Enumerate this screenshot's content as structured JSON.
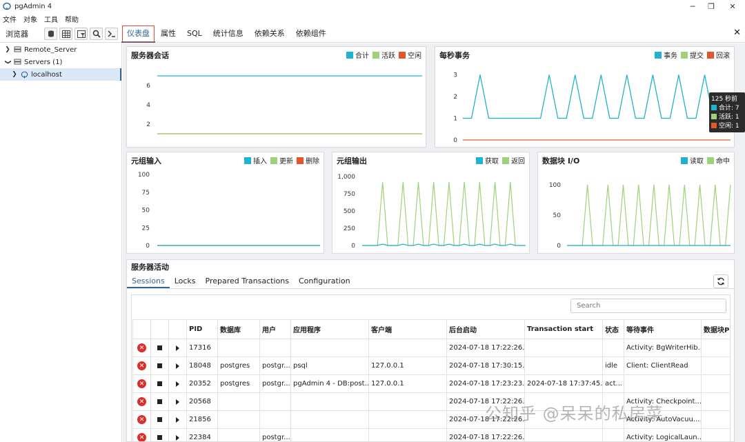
{
  "window": {
    "title": "pgAdmin 4"
  },
  "menu": [
    "文件",
    "对象",
    "工具",
    "帮助"
  ],
  "toolbar": {
    "browser_label": "浏览器",
    "tabs": [
      "仪表盘",
      "属性",
      "SQL",
      "统计信息",
      "依赖关系",
      "依赖组件"
    ],
    "active_tab": "仪表盘",
    "icons": [
      "database-icon",
      "table-icon",
      "filter-table-icon",
      "search-icon",
      "terminal-icon"
    ]
  },
  "tree": [
    {
      "label": "Remote_Server",
      "expanded": false,
      "icon": "server-group-icon"
    },
    {
      "label": "Servers (1)",
      "expanded": true,
      "icon": "server-group-icon"
    },
    {
      "label": "localhost",
      "expanded": false,
      "icon": "postgres-server-icon",
      "selected": true
    }
  ],
  "colors": {
    "blue": "#1fb3d1",
    "green": "#9ed27a",
    "orange": "#e3552a",
    "accent": "#326690"
  },
  "panels": {
    "sessions": {
      "title": "服务器会话",
      "legend": [
        "合计",
        "活跃",
        "空闲"
      ]
    },
    "tps": {
      "title": "每秒事务",
      "legend": [
        "事务",
        "提交",
        "回滚"
      ]
    },
    "tuples_in": {
      "title": "元组输入",
      "legend": [
        "插入",
        "更新",
        "删除"
      ]
    },
    "tuples_out": {
      "title": "元组输出",
      "legend": [
        "获取",
        "返回"
      ]
    },
    "block_io": {
      "title": "数据块 I/O",
      "legend": [
        "读取",
        "命中"
      ]
    }
  },
  "tooltip": {
    "title": "125 秒前",
    "rows": [
      "合计: 7",
      "活跃: 1",
      "空闲: 1"
    ]
  },
  "chart_data": [
    {
      "type": "line",
      "title": "服务器会话",
      "yticks": [
        "2",
        "4",
        "6"
      ],
      "ylim": [
        0,
        8
      ],
      "series": [
        {
          "name": "合计",
          "color": "#1fb3d1",
          "values": [
            7,
            7,
            7,
            7,
            7,
            7,
            7,
            7,
            7,
            7,
            7,
            7,
            7
          ]
        },
        {
          "name": "活跃",
          "color": "#9ed27a",
          "values": [
            1,
            1,
            1,
            1,
            1,
            1,
            1,
            1,
            1,
            1,
            1,
            1,
            1
          ]
        },
        {
          "name": "空闲",
          "color": "#e3552a",
          "values": [
            1,
            1,
            1,
            1,
            1,
            1,
            1,
            1,
            1,
            1,
            1,
            1,
            1
          ]
        }
      ]
    },
    {
      "type": "line",
      "title": "每秒事务",
      "yticks": [
        "0",
        "1",
        "2",
        "3"
      ],
      "ylim": [
        0,
        3.3
      ],
      "series": [
        {
          "name": "事务",
          "color": "#1fb3d1",
          "values": [
            1,
            1,
            3,
            1,
            1,
            1,
            1,
            1,
            1,
            1,
            3,
            1,
            1,
            3,
            1,
            1,
            3,
            1,
            1,
            3,
            1,
            1,
            3,
            1,
            1,
            3,
            1,
            1,
            3,
            1,
            1,
            1
          ]
        },
        {
          "name": "提交",
          "color": "#9ed27a",
          "values": [
            1,
            1,
            3,
            1,
            1,
            1,
            1,
            1,
            1,
            1,
            3,
            1,
            1,
            3,
            1,
            1,
            3,
            1,
            1,
            3,
            1,
            1,
            3,
            1,
            1,
            3,
            1,
            1,
            3,
            1,
            1,
            1
          ]
        },
        {
          "name": "回滚",
          "color": "#e3552a",
          "values": [
            0,
            0,
            0,
            0,
            0,
            0,
            0,
            0,
            0,
            0,
            0,
            0,
            0,
            0,
            0,
            0,
            0,
            0,
            0,
            0,
            0,
            0,
            0,
            0,
            0,
            0,
            0,
            0,
            0,
            0,
            0,
            0
          ]
        }
      ]
    },
    {
      "type": "line",
      "title": "元组输入",
      "yticks": [
        "0",
        "25",
        "50",
        "75",
        "100"
      ],
      "ylim": [
        0,
        100
      ],
      "series": [
        {
          "name": "插入",
          "color": "#1fb3d1",
          "values": [
            0,
            0,
            0,
            0,
            0,
            0,
            0,
            0,
            0,
            0
          ]
        },
        {
          "name": "更新",
          "color": "#9ed27a",
          "values": [
            0,
            0,
            0,
            0,
            0,
            0,
            0,
            0,
            0,
            0
          ]
        },
        {
          "name": "删除",
          "color": "#e3552a",
          "values": [
            0,
            0,
            0,
            0,
            0,
            0,
            0,
            0,
            0,
            0
          ]
        }
      ]
    },
    {
      "type": "line",
      "title": "元组输出",
      "yticks": [
        "0",
        "250",
        "500",
        "750",
        "1,000"
      ],
      "ylim": [
        0,
        1000
      ],
      "series": [
        {
          "name": "获取",
          "color": "#1fb3d1",
          "values": [
            0,
            0,
            0,
            0,
            20,
            0,
            0,
            0,
            20,
            0,
            0,
            20,
            0,
            0,
            20,
            0,
            0,
            20,
            0,
            0,
            20,
            0,
            0,
            20,
            0,
            0,
            20,
            0,
            0,
            20,
            0,
            0,
            0
          ]
        },
        {
          "name": "返回",
          "color": "#9ed27a",
          "values": [
            0,
            0,
            0,
            0,
            920,
            0,
            0,
            0,
            920,
            0,
            0,
            920,
            0,
            0,
            920,
            0,
            0,
            920,
            0,
            0,
            920,
            0,
            0,
            920,
            0,
            0,
            920,
            0,
            0,
            920,
            0,
            0,
            0
          ]
        }
      ]
    },
    {
      "type": "line",
      "title": "数据块 I/O",
      "yticks": [
        "0",
        "50",
        "100"
      ],
      "ylim": [
        0,
        110
      ],
      "series": [
        {
          "name": "读取",
          "color": "#1fb3d1",
          "values": [
            0,
            0,
            0,
            0,
            0,
            0,
            0,
            0,
            0,
            0,
            0,
            0,
            0,
            0,
            0,
            0,
            0,
            0,
            0,
            0,
            0,
            0,
            0,
            0,
            0,
            0,
            0,
            0,
            0,
            0,
            0,
            0,
            0
          ]
        },
        {
          "name": "命中",
          "color": "#9ed27a",
          "values": [
            0,
            0,
            0,
            0,
            100,
            0,
            0,
            0,
            100,
            0,
            0,
            100,
            0,
            0,
            100,
            0,
            0,
            100,
            0,
            0,
            100,
            0,
            0,
            100,
            0,
            0,
            100,
            0,
            0,
            100,
            0,
            0,
            100
          ]
        }
      ]
    }
  ],
  "activity": {
    "title": "服务器活动",
    "tabs": [
      "Sessions",
      "Locks",
      "Prepared Transactions",
      "Configuration"
    ],
    "search_placeholder": "Search",
    "columns": [
      "",
      "",
      "",
      "PID",
      "数据库",
      "用户",
      "应用程序",
      "客户端",
      "后台启动",
      "Transaction start",
      "状态",
      "等待事件",
      "数据块PI"
    ],
    "rows": [
      {
        "pid": "17316",
        "db": "",
        "user": "",
        "app": "",
        "client": "",
        "backend_start": "2024-07-18 17:22:26...",
        "xact_start": "",
        "state": "",
        "wait": "Activity: BgWriterHib..."
      },
      {
        "pid": "18048",
        "db": "postgres",
        "user": "postgr...",
        "app": "psql",
        "client": "127.0.0.1",
        "backend_start": "2024-07-18 17:30:15...",
        "xact_start": "",
        "state": "idle",
        "wait": "Client: ClientRead"
      },
      {
        "pid": "20352",
        "db": "postgres",
        "user": "postgr...",
        "app": "pgAdmin 4 - DB:post...",
        "client": "127.0.0.1",
        "backend_start": "2024-07-18 17:23:23...",
        "xact_start": "2024-07-18 17:37:45...",
        "state": "act...",
        "wait": ""
      },
      {
        "pid": "20568",
        "db": "",
        "user": "",
        "app": "",
        "client": "",
        "backend_start": "2024-07-18 17:22:26...",
        "xact_start": "",
        "state": "",
        "wait": "Activity: Checkpoint..."
      },
      {
        "pid": "21856",
        "db": "",
        "user": "",
        "app": "",
        "client": "",
        "backend_start": "2024-07-18 17:22:26...",
        "xact_start": "",
        "state": "",
        "wait": "Activity: AutoVacuu..."
      },
      {
        "pid": "22384",
        "db": "",
        "user": "postgr...",
        "app": "",
        "client": "",
        "backend_start": "2024-07-18 17:22:26...",
        "xact_start": "",
        "state": "",
        "wait": "Activity: LogicalLaun..."
      }
    ]
  },
  "watermark": "公知乎 @呆呆的私房菜"
}
